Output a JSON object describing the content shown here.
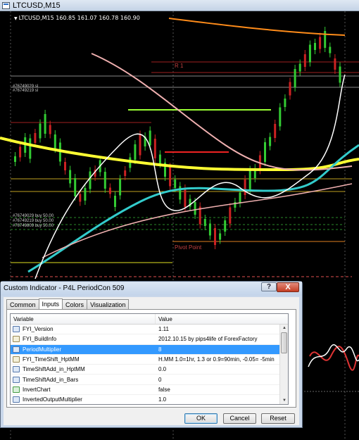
{
  "window": {
    "title": "LTCUSD,M15"
  },
  "chart": {
    "symbol_line": "LTCUSD,M15  160.85 161.07 160.78 160.90",
    "labels": {
      "r1": "R 1",
      "pivot": "Pivot Point",
      "order1": "#76749029 sl",
      "order2": "#76749219 sl",
      "buy1": "#76749029 buy 50.00",
      "buy2": "#76749219 buy 50.00",
      "buy3": "#76749809 buy 50.00"
    },
    "colors": {
      "background": "#000000",
      "up_candle": "#33cc33",
      "down_candle": "#cc2222",
      "yellow_ma": "#ffff33",
      "cyan_ma": "#33cccc",
      "orange_ma": "#ff8c1a",
      "pink_ma": "#f0b0b0",
      "white_ma": "#ffffff"
    }
  },
  "dialog": {
    "title": "Custom Indicator - P4L PeriodCon 509",
    "help_label": "?",
    "close_label": "X",
    "tabs": [
      {
        "label": "Common"
      },
      {
        "label": "Inputs"
      },
      {
        "label": "Colors"
      },
      {
        "label": "Visualization"
      }
    ],
    "columns": {
      "variable": "Variable",
      "value": "Value"
    },
    "rows": [
      {
        "icon": "Va",
        "variable": "FYI_Version",
        "value": "1.11"
      },
      {
        "icon": "ab",
        "variable": "FYI_BuildInfo",
        "value": "2012.10.15 by pips4life of ForexFactory"
      },
      {
        "icon": "123",
        "variable": "PeriodMultiplier",
        "value": "8"
      },
      {
        "icon": "ab",
        "variable": "FYI_TimeShift_HptMM",
        "value": "H.MM 1.0=1hr, 1.3 or 0.9=90min, -0.05= -5min"
      },
      {
        "icon": "Va",
        "variable": "TimeShiftAdd_in_HptMM",
        "value": "0.0"
      },
      {
        "icon": "123",
        "variable": "TimeShiftAdd_in_Bars",
        "value": "0"
      },
      {
        "icon": "bool",
        "variable": "InvertChart",
        "value": "false"
      },
      {
        "icon": "Va",
        "variable": "InvertedOutputMultiplier",
        "value": "1.0"
      }
    ],
    "selected_row": 2,
    "buttons": {
      "ok": "OK",
      "cancel": "Cancel",
      "reset": "Reset"
    }
  }
}
